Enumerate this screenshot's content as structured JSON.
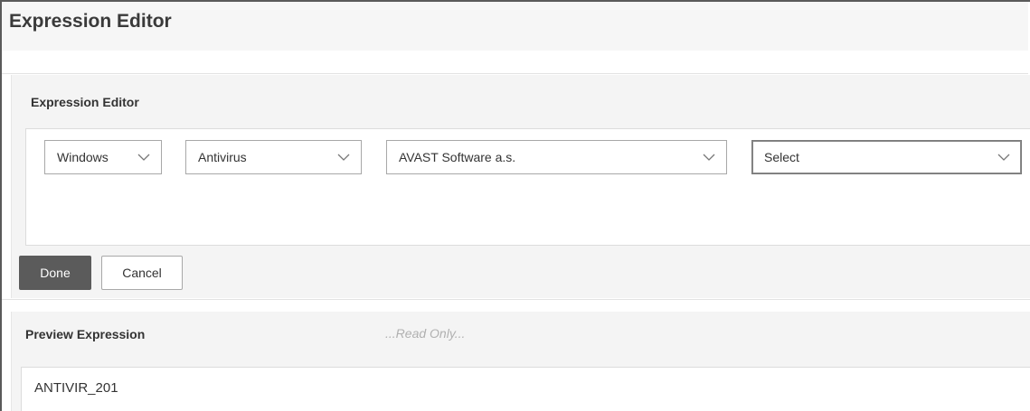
{
  "dialog": {
    "title": "Expression Editor"
  },
  "editor": {
    "section_label": "Expression Editor",
    "dropdowns": [
      {
        "selected": "Windows",
        "icon": "chevron-down-icon"
      },
      {
        "selected": "Antivirus",
        "icon": "chevron-down-icon"
      },
      {
        "selected": "AVAST Software a.s.",
        "icon": "chevron-down-icon"
      },
      {
        "selected": "Select",
        "icon": "chevron-down-icon"
      }
    ],
    "done_label": "Done",
    "cancel_label": "Cancel"
  },
  "preview": {
    "section_label": "Preview Expression",
    "readonly_hint": "...Read Only...",
    "expression": "ANTIVIR_201"
  },
  "colors": {
    "primary_button": "#5b5b5b",
    "panel_background": "#f4f4f4"
  }
}
